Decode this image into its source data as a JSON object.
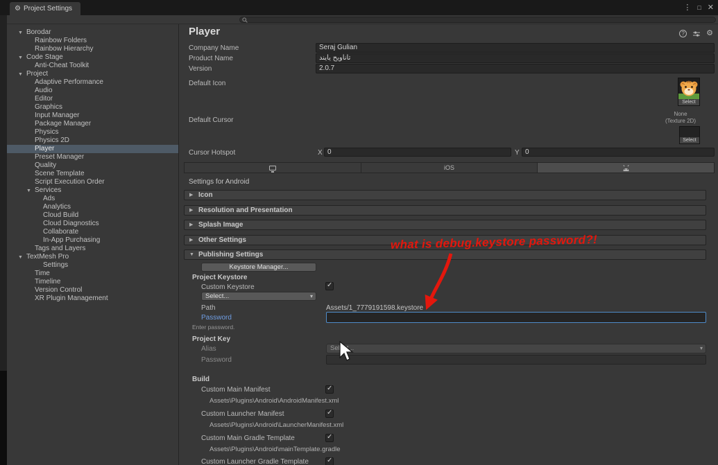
{
  "window": {
    "tab_title": "Project Settings"
  },
  "icons": {
    "settings_gear": "⚙",
    "window_menu": "⋮",
    "window_float": "□",
    "window_close": "✕",
    "help": "?",
    "fold_open": "▼",
    "fold_closed": "▶",
    "tree_open": "▼",
    "dropdown_arrow": "▾",
    "check": "✓"
  },
  "colors": {
    "annotation_red": "#e3170d",
    "focus_blue": "#4f8cc9",
    "selected_row": "#4e5a66",
    "highlight_label_blue": "#6f9de2"
  },
  "sidebar": {
    "items": [
      {
        "label": "Borodar",
        "depth": 0,
        "expanded": true
      },
      {
        "label": "Rainbow Folders",
        "depth": 1
      },
      {
        "label": "Rainbow Hierarchy",
        "depth": 1
      },
      {
        "label": "Code Stage",
        "depth": 0,
        "expanded": true
      },
      {
        "label": "Anti-Cheat Toolkit",
        "depth": 1
      },
      {
        "label": "Project",
        "depth": 0,
        "expanded": true
      },
      {
        "label": "Adaptive Performance",
        "depth": 1
      },
      {
        "label": "Audio",
        "depth": 1
      },
      {
        "label": "Editor",
        "depth": 1
      },
      {
        "label": "Graphics",
        "depth": 1
      },
      {
        "label": "Input Manager",
        "depth": 1
      },
      {
        "label": "Package Manager",
        "depth": 1
      },
      {
        "label": "Physics",
        "depth": 1
      },
      {
        "label": "Physics 2D",
        "depth": 1
      },
      {
        "label": "Player",
        "depth": 1,
        "selected": true
      },
      {
        "label": "Preset Manager",
        "depth": 1
      },
      {
        "label": "Quality",
        "depth": 1
      },
      {
        "label": "Scene Template",
        "depth": 1
      },
      {
        "label": "Script Execution Order",
        "depth": 1
      },
      {
        "label": "Services",
        "depth": 1,
        "expanded": true
      },
      {
        "label": "Ads",
        "depth": 2
      },
      {
        "label": "Analytics",
        "depth": 2
      },
      {
        "label": "Cloud Build",
        "depth": 2
      },
      {
        "label": "Cloud Diagnostics",
        "depth": 2
      },
      {
        "label": "Collaborate",
        "depth": 2
      },
      {
        "label": "In-App Purchasing",
        "depth": 2
      },
      {
        "label": "Tags and Layers",
        "depth": 1
      },
      {
        "label": "TextMesh Pro",
        "depth": 0,
        "expanded": true
      },
      {
        "label": "Settings",
        "depth": 2
      },
      {
        "label": "Time",
        "depth": 1
      },
      {
        "label": "Timeline",
        "depth": 1
      },
      {
        "label": "Version Control",
        "depth": 1
      },
      {
        "label": "XR Plugin Management",
        "depth": 1
      }
    ]
  },
  "main": {
    "title": "Player",
    "company": {
      "label": "Company Name",
      "value": "Seraj Gulian"
    },
    "product": {
      "label": "Product Name",
      "value": "تاناويح یایند"
    },
    "version": {
      "label": "Version",
      "value": "2.0.7"
    },
    "default_icon_label": "Default Icon",
    "default_cursor_label": "Default Cursor",
    "icon_select_label": "Select",
    "cursor_none": "None",
    "cursor_type": "(Texture 2D)",
    "cursor_select_label": "Select",
    "hotspot": {
      "label": "Cursor Hotspot",
      "x_label": "X",
      "x_value": "0",
      "y_label": "Y",
      "y_value": "0"
    },
    "platform_tabs": {
      "ios": "iOS"
    },
    "settings_header": "Settings for Android",
    "sections": [
      "Icon",
      "Resolution and Presentation",
      "Splash Image",
      "Other Settings",
      "Publishing Settings"
    ],
    "publishing": {
      "keystore_manager_button": "Keystore Manager...",
      "project_keystore_label": "Project Keystore",
      "custom_keystore_label": "Custom Keystore",
      "keystore_dropdown_value": "Select...",
      "path_label": "Path",
      "path_value": "Assets/1_7779191598.keystore",
      "password_label": "Password",
      "password_value": "",
      "enter_password_hint": "Enter password.",
      "project_key_label": "Project Key",
      "alias_label": "Alias",
      "alias_dropdown_value": "Select...",
      "key_password_label": "Password",
      "build_label": "Build",
      "build_items": [
        {
          "label": "Custom Main Manifest",
          "path": "Assets\\Plugins\\Android\\AndroidManifest.xml"
        },
        {
          "label": "Custom Launcher Manifest",
          "path": "Assets\\Plugins\\Android\\LauncherManifest.xml"
        },
        {
          "label": "Custom Main Gradle Template",
          "path": "Assets\\Plugins\\Android\\mainTemplate.gradle"
        },
        {
          "label": "Custom Launcher Gradle Template",
          "path": ""
        }
      ]
    }
  },
  "annotation": {
    "text": "what is debug.keystore password?!"
  }
}
